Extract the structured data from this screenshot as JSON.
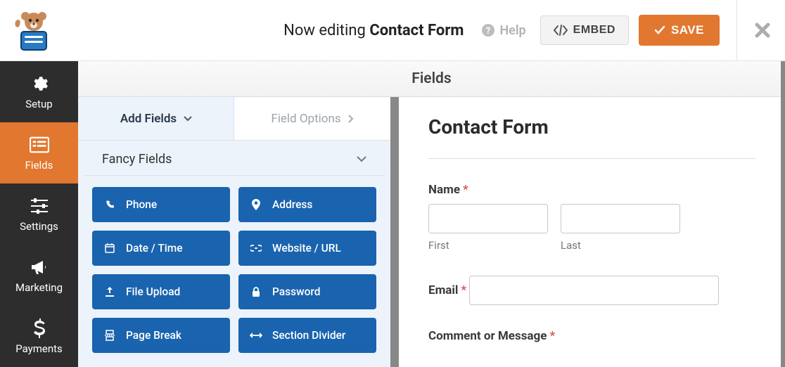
{
  "topbar": {
    "editing_prefix": "Now editing ",
    "editing_name": "Contact Form",
    "help_label": "Help",
    "embed_label": "EMBED",
    "save_label": "SAVE"
  },
  "rail": {
    "items": [
      {
        "label": "Setup"
      },
      {
        "label": "Fields"
      },
      {
        "label": "Settings"
      },
      {
        "label": "Marketing"
      },
      {
        "label": "Payments"
      }
    ],
    "active_index": 1
  },
  "fields_header": "Fields",
  "panel": {
    "tab_add": "Add Fields",
    "tab_options": "Field Options",
    "section_title": "Fancy Fields",
    "fields": [
      {
        "label": "Phone",
        "icon": "phone-icon"
      },
      {
        "label": "Address",
        "icon": "pin-icon"
      },
      {
        "label": "Date / Time",
        "icon": "calendar-icon"
      },
      {
        "label": "Website / URL",
        "icon": "link-icon"
      },
      {
        "label": "File Upload",
        "icon": "upload-icon"
      },
      {
        "label": "Password",
        "icon": "lock-icon"
      },
      {
        "label": "Page Break",
        "icon": "pagebreak-icon"
      },
      {
        "label": "Section Divider",
        "icon": "divider-icon"
      }
    ]
  },
  "preview": {
    "form_title": "Contact Form",
    "name_label": "Name",
    "required_mark": "*",
    "first_sub": "First",
    "last_sub": "Last",
    "email_label": "Email",
    "comment_label": "Comment or Message"
  }
}
